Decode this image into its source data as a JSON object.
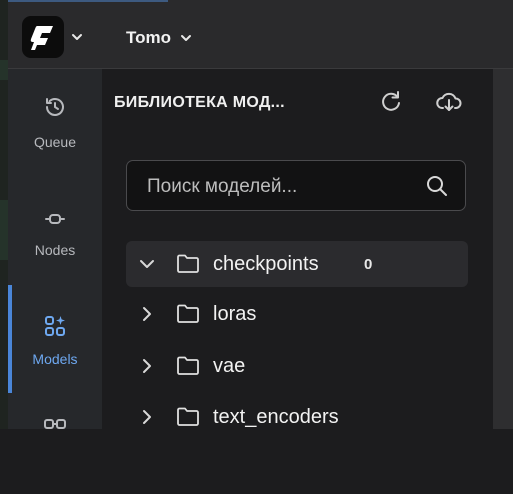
{
  "topbar": {
    "workspace_name": "Tomo"
  },
  "sidebar": {
    "items": [
      {
        "id": "queue",
        "label": "Queue"
      },
      {
        "id": "nodes",
        "label": "Nodes"
      },
      {
        "id": "models",
        "label": "Models",
        "active": true
      },
      {
        "id": "workflows",
        "label": ""
      }
    ]
  },
  "library": {
    "title": "БИБЛИОТЕКА МОД...",
    "search_placeholder": "Поиск моделей...",
    "search_value": "",
    "folders": [
      {
        "name": "checkpoints",
        "count": "0",
        "expanded": true
      },
      {
        "name": "loras"
      },
      {
        "name": "vae"
      },
      {
        "name": "text_encoders"
      }
    ]
  },
  "colors": {
    "accent": "#4a86d8",
    "active_label": "#6ea8f0",
    "panel_bg": "#1c1c1e",
    "sidenav_bg": "#26282b"
  }
}
